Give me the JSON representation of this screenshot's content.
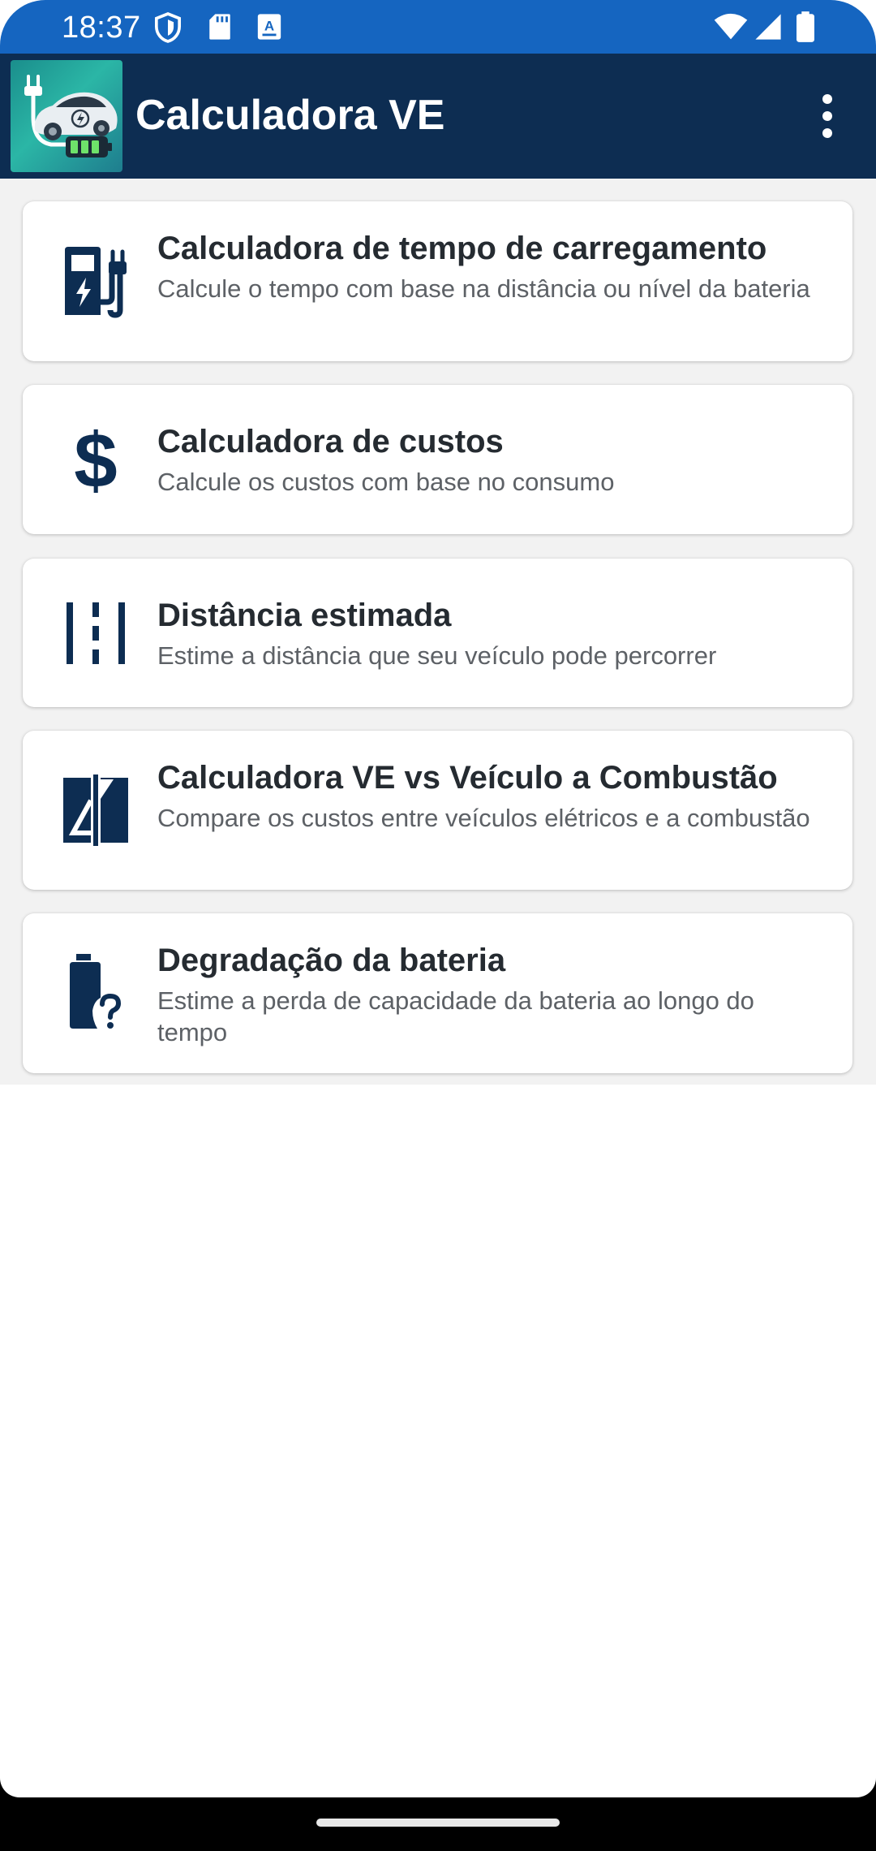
{
  "status_bar": {
    "time": "18:37",
    "left_icons": [
      "shield-icon",
      "sd-card-icon",
      "keyboard-a-icon"
    ],
    "right_icons": [
      "wifi-icon",
      "cell-signal-icon",
      "battery-icon"
    ]
  },
  "app_bar": {
    "title": "Calculadora VE",
    "logo": "ev-car-charging-logo",
    "menu_icon": "overflow-menu-icon"
  },
  "cards": [
    {
      "icon": "ev-station-icon",
      "title": "Calculadora de tempo de carregamento",
      "subtitle": "Calcule o tempo com base na distância ou nível da bateria"
    },
    {
      "icon": "dollar-icon",
      "title": "Calculadora de custos",
      "subtitle": "Calcule os custos com base no consumo"
    },
    {
      "icon": "road-add-icon",
      "title": "Distância estimada",
      "subtitle": "Estime a distância que seu veículo pode percorrer"
    },
    {
      "icon": "compare-icon",
      "title": "Calculadora VE vs Veículo a Combustão",
      "subtitle": "Compare os custos entre veículos elétricos e a combustão"
    },
    {
      "icon": "battery-unknown-icon",
      "title": "Degradação da bateria",
      "subtitle": "Estime a perda de capacidade da bateria ao longo do tempo"
    }
  ],
  "colors": {
    "status_bar": "#1565c0",
    "app_bar": "#0d2d52",
    "icon": "#0d2d52",
    "title_text": "#252b31",
    "subtitle_text": "#5d6166",
    "content_bg": "#f2f2f2"
  }
}
